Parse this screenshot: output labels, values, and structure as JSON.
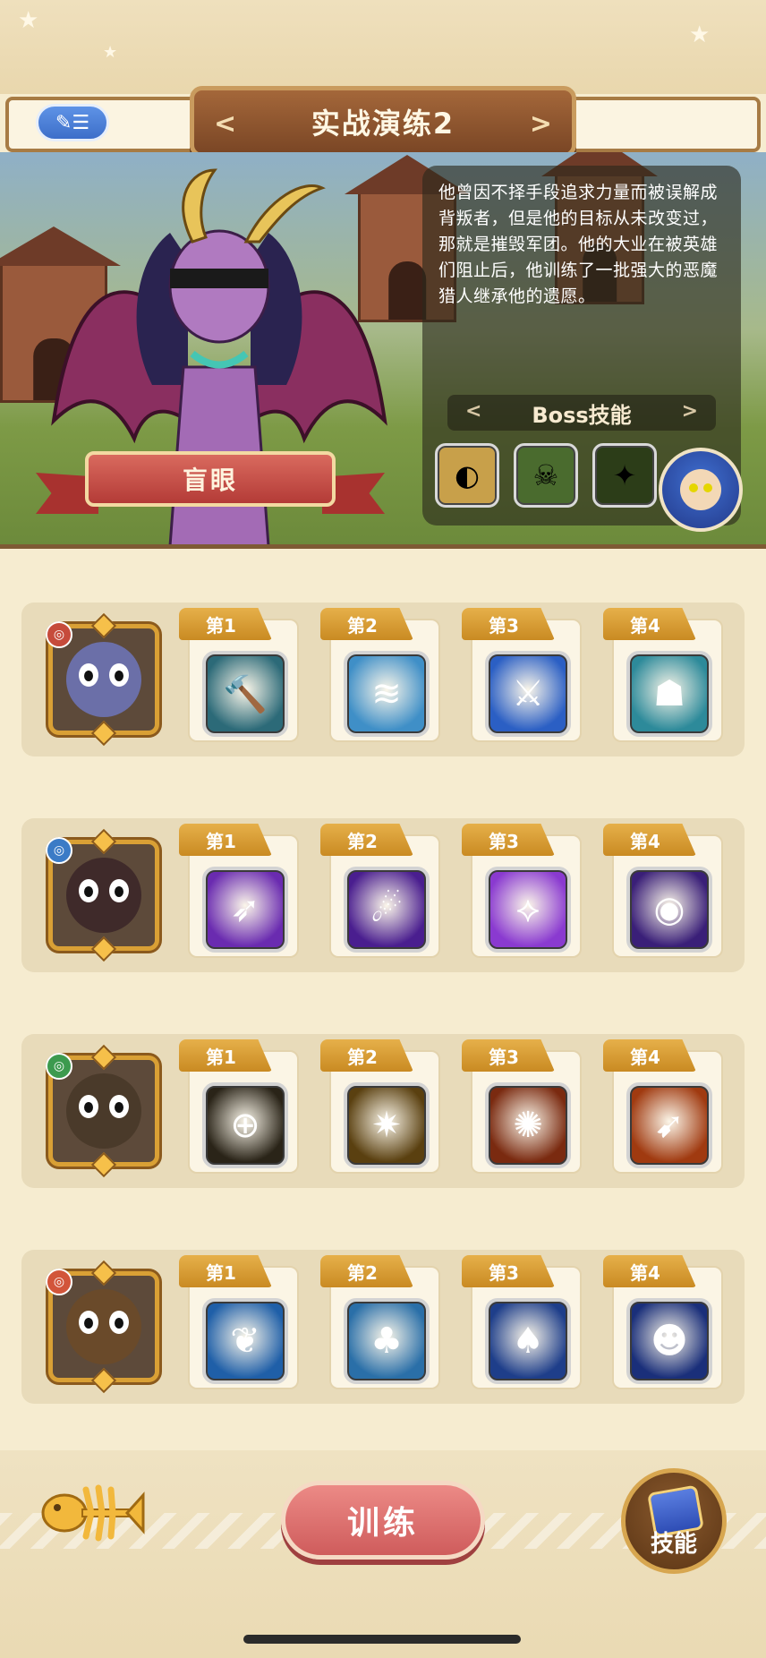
{
  "header": {
    "back_icon_label": "✎☰",
    "title": "实战演练2"
  },
  "boss": {
    "name": "盲眼",
    "description": "他曾因不择手段追求力量而被误解成背叛者，但是他的目标从未改变过，那就是摧毁军团。他的大业在被英雄们阻止后，他训练了一批强大的恶魔猎人继承他的遗愿。",
    "skills_title": "Boss技能",
    "skills": [
      {
        "icon": "golden-mask-skill-icon",
        "color": "#c8a04a"
      },
      {
        "icon": "green-skull-skill-icon",
        "color": "#4a6b2e"
      },
      {
        "icon": "green-flame-skill-icon",
        "color": "#2c3d18"
      }
    ]
  },
  "heroes": [
    {
      "hero_icon": "armored-penguin-hero-icon",
      "hero_color": "#6b6fa8",
      "faction_color": "#c64b3b",
      "skills": [
        {
          "rank": "第1",
          "icon": "hammer-skill-icon",
          "color": "#2c6a78"
        },
        {
          "rank": "第2",
          "icon": "splash-skill-icon",
          "color": "#3f8fc7"
        },
        {
          "rank": "第3",
          "icon": "ice-slash-skill-icon",
          "color": "#2b5fc4"
        },
        {
          "rank": "第4",
          "icon": "shadow-beast-skill-icon",
          "color": "#2d8a9a"
        }
      ]
    },
    {
      "hero_icon": "bandaged-skull-hero-icon",
      "hero_color": "#3f2a2a",
      "faction_color": "#3b7bc6",
      "skills": [
        {
          "rank": "第1",
          "icon": "purple-arrows-skill-icon",
          "color": "#6a2bb0"
        },
        {
          "rank": "第2",
          "icon": "comet-skill-icon",
          "color": "#4a1e8f"
        },
        {
          "rank": "第3",
          "icon": "arcane-blade-skill-icon",
          "color": "#8a3ad0"
        },
        {
          "rank": "第4",
          "icon": "eye-crystal-skill-icon",
          "color": "#3a1f78"
        }
      ]
    },
    {
      "hero_icon": "blue-fish-warrior-hero-icon",
      "hero_color": "#4a3a2a",
      "faction_color": "#3c9a4e",
      "skills": [
        {
          "rank": "第1",
          "icon": "target-reticle-skill-icon",
          "color": "#2a2418"
        },
        {
          "rank": "第2",
          "icon": "golden-burst-skill-icon",
          "color": "#5a4010"
        },
        {
          "rank": "第3",
          "icon": "fire-vortex-skill-icon",
          "color": "#7a2a10"
        },
        {
          "rank": "第4",
          "icon": "flaming-spear-skill-icon",
          "color": "#a03a10"
        }
      ]
    },
    {
      "hero_icon": "tree-spirit-hero-icon",
      "hero_color": "#6a4a2a",
      "faction_color": "#d2553a",
      "skills": [
        {
          "rank": "第1",
          "icon": "green-leaf-skill-icon",
          "color": "#1f5fa8"
        },
        {
          "rank": "第2",
          "icon": "treant-skill-icon",
          "color": "#2a6fa8"
        },
        {
          "rank": "第3",
          "icon": "autumn-tree-skill-icon",
          "color": "#1e3e8a"
        },
        {
          "rank": "第4",
          "icon": "dark-totem-skill-icon",
          "color": "#1a2f7a"
        }
      ]
    }
  ],
  "footer": {
    "fish_icon": "fishbone-icon",
    "train_label": "训练",
    "skills_label": "技能"
  }
}
